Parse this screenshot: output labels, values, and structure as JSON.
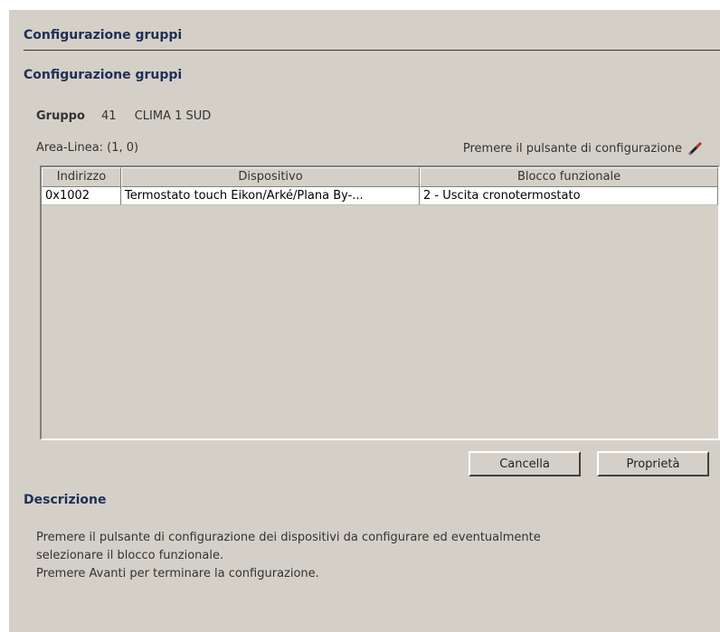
{
  "header": {
    "title": "Configurazione gruppi",
    "subtitle": "Configurazione gruppi"
  },
  "group": {
    "label": "Gruppo",
    "number": "41",
    "name": "CLIMA 1 SUD"
  },
  "area": {
    "text": "Area-Linea: (1, 0)"
  },
  "prompt": {
    "text": "Premere il pulsante di configurazione"
  },
  "table": {
    "columns": [
      "Indirizzo",
      "Dispositivo",
      "Blocco funzionale"
    ],
    "rows": [
      {
        "address": "0x1002",
        "device": "Termostato touch Eikon/Arké/Plana By-...",
        "block": "2 - Uscita cronotermostato"
      }
    ]
  },
  "buttons": {
    "cancel": "Cancella",
    "properties": "Proprietà"
  },
  "description": {
    "title": "Descrizione",
    "lines": [
      "Premere il pulsante di configurazione dei dispositivi da configurare ed eventualmente",
      "selezionare il blocco funzionale.",
      "Premere Avanti per terminare la configurazione."
    ]
  },
  "colors": {
    "panel": "#d4d0c8",
    "header_text": "#1f2f57"
  },
  "icons": {
    "prompt_icon": "pen-icon"
  }
}
